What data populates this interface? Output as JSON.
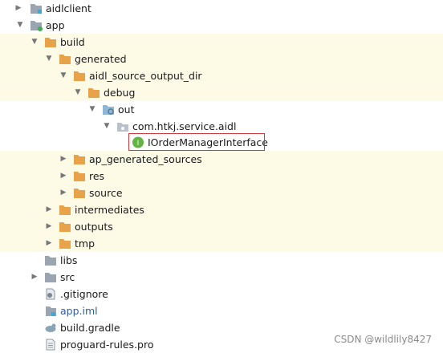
{
  "tree": {
    "aidlclient": "aidlclient",
    "app": "app",
    "build": "build",
    "generated": "generated",
    "aidl_source_output_dir": "aidl_source_output_dir",
    "debug": "debug",
    "out": "out",
    "package": "com.htkj.service.aidl",
    "interface_file": "IOrderManagerInterface",
    "interface_badge": "I",
    "ap_generated_sources": "ap_generated_sources",
    "res": "res",
    "source": "source",
    "intermediates": "intermediates",
    "outputs": "outputs",
    "tmp": "tmp",
    "libs": "libs",
    "src": "src",
    "gitignore": ".gitignore",
    "app_iml": "app.iml",
    "build_gradle": "build.gradle",
    "proguard": "proguard-rules.pro"
  },
  "watermark": "CSDN @wildlily8427",
  "colors": {
    "folder_orange": "#e8a24a",
    "folder_gray": "#9aa5b1",
    "row_highlight": "#fdfbe6",
    "selection_border": "#d23a3a",
    "iml_text": "#2c5da8",
    "interface_badge": "#62b543"
  }
}
